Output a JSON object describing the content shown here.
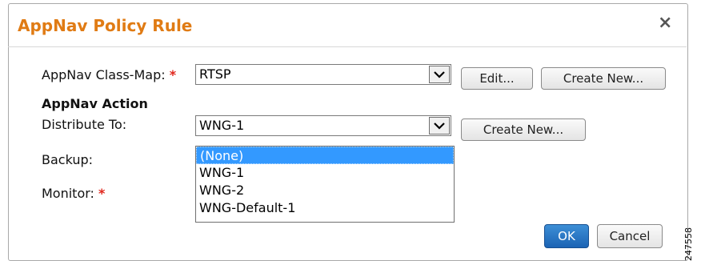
{
  "dialog": {
    "title": "AppNav Policy Rule",
    "close": "×"
  },
  "form": {
    "class_map_label": "AppNav Class-Map:",
    "class_map_value": "RTSP",
    "edit_button": "Edit...",
    "create_new_1": "Create New...",
    "section_header": "AppNav Action",
    "distribute_label": "Distribute To:",
    "distribute_value": "WNG-1",
    "create_new_2": "Create New...",
    "backup_label": "Backup:",
    "monitor_label": "Monitor:",
    "required_mark": "*",
    "dropdown_arrow": "✔"
  },
  "backup_options": [
    "(None)",
    "WNG-1",
    "WNG-2",
    "WNG-Default-1"
  ],
  "backup_selected": "(None)",
  "actions": {
    "ok": "OK",
    "cancel": "Cancel"
  },
  "side_number": "247558",
  "colors": {
    "title": "#e07b14",
    "required": "#e0251b",
    "selection": "#3399ff",
    "primary_button": "#1b63b4"
  }
}
